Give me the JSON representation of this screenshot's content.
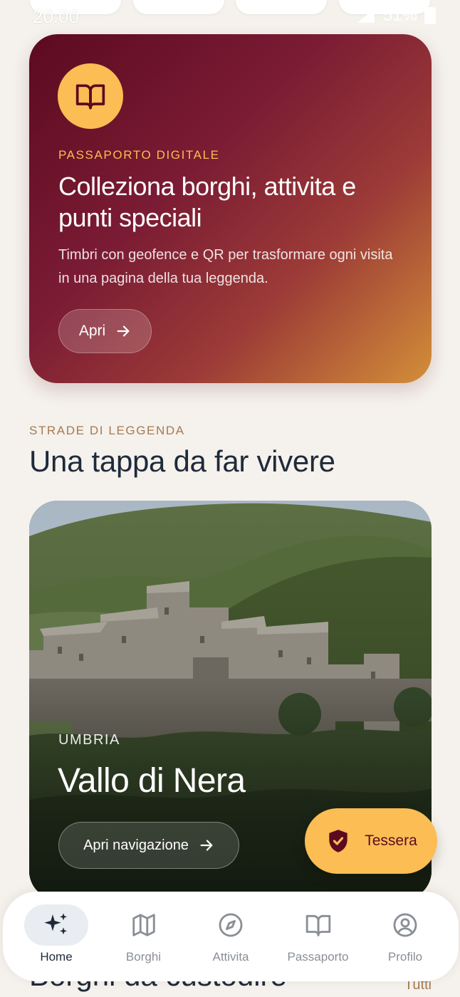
{
  "status_bar": {
    "time": "20:00",
    "battery": "51%"
  },
  "passport_card": {
    "icon": "book-icon",
    "eyebrow": "PASSAPORTO DIGITALE",
    "title": "Colleziona borghi, attivita e punti speciali",
    "description": "Timbri con geofence e QR per trasformare ogni visita in una pagina della tua leggenda.",
    "button_label": "Apri"
  },
  "section": {
    "eyebrow": "STRADE DI LEGGENDA",
    "title": "Una tappa da far vivere"
  },
  "destination": {
    "region": "UMBRIA",
    "name": "Vallo di Nera",
    "button_label": "Apri navigazione"
  },
  "fab": {
    "label": "Tessera",
    "icon": "shield-check-icon"
  },
  "next_section": {
    "title": "Borghi da custodire",
    "link": "Tutti"
  },
  "bottom_nav": {
    "items": [
      {
        "label": "Home",
        "icon": "sparkles-icon",
        "active": true
      },
      {
        "label": "Borghi",
        "icon": "map-icon",
        "active": false
      },
      {
        "label": "Attivita",
        "icon": "compass-icon",
        "active": false
      },
      {
        "label": "Passaporto",
        "icon": "book-icon",
        "active": false
      },
      {
        "label": "Profilo",
        "icon": "user-circle-icon",
        "active": false
      }
    ]
  },
  "colors": {
    "background": "#f5f1ec",
    "accent_gold": "#fbbd54",
    "accent_burgundy": "#5c0a20",
    "eyebrow_brown": "#a57a4f"
  }
}
